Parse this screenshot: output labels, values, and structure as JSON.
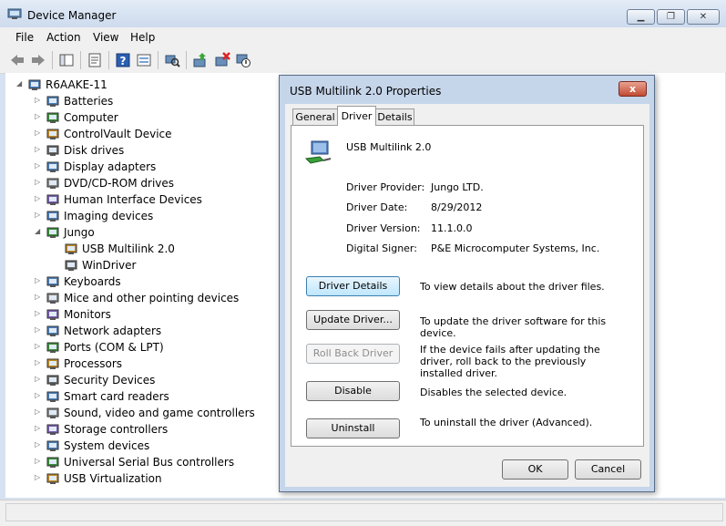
{
  "window": {
    "title": "Device Manager"
  },
  "menu": [
    "File",
    "Action",
    "View",
    "Help"
  ],
  "tree": {
    "root": "R6AAKE-11",
    "items": [
      {
        "label": "Batteries",
        "expanded": false
      },
      {
        "label": "Computer",
        "expanded": false
      },
      {
        "label": "ControlVault Device",
        "expanded": false
      },
      {
        "label": "Disk drives",
        "expanded": false
      },
      {
        "label": "Display adapters",
        "expanded": false
      },
      {
        "label": "DVD/CD-ROM drives",
        "expanded": false
      },
      {
        "label": "Human Interface Devices",
        "expanded": false
      },
      {
        "label": "Imaging devices",
        "expanded": false
      },
      {
        "label": "Jungo",
        "expanded": true
      },
      {
        "label": "USB Multilink 2.0",
        "child": true
      },
      {
        "label": "WinDriver",
        "child": true
      },
      {
        "label": "Keyboards",
        "expanded": false
      },
      {
        "label": "Mice and other pointing devices",
        "expanded": false
      },
      {
        "label": "Monitors",
        "expanded": false
      },
      {
        "label": "Network adapters",
        "expanded": false
      },
      {
        "label": "Ports (COM & LPT)",
        "expanded": false
      },
      {
        "label": "Processors",
        "expanded": false
      },
      {
        "label": "Security Devices",
        "expanded": false
      },
      {
        "label": "Smart card readers",
        "expanded": false
      },
      {
        "label": "Sound, video and game controllers",
        "expanded": false
      },
      {
        "label": "Storage controllers",
        "expanded": false
      },
      {
        "label": "System devices",
        "expanded": false
      },
      {
        "label": "Universal Serial Bus controllers",
        "expanded": false
      },
      {
        "label": "USB Virtualization",
        "expanded": false
      }
    ]
  },
  "dialog": {
    "title": "USB Multilink 2.0 Properties",
    "close_label": "x",
    "tabs": [
      "General",
      "Driver",
      "Details"
    ],
    "active_tab": "Driver",
    "device_name": "USB Multilink 2.0",
    "fields": [
      {
        "label": "Driver Provider:",
        "value": "Jungo LTD."
      },
      {
        "label": "Driver Date:",
        "value": "8/29/2012"
      },
      {
        "label": "Driver Version:",
        "value": "11.1.0.0"
      },
      {
        "label": "Digital Signer:",
        "value": "P&E Microcomputer Systems, Inc."
      }
    ],
    "actions": [
      {
        "button": "Driver Details",
        "desc": "To view details about the driver files.",
        "state": "focused"
      },
      {
        "button": "Update Driver...",
        "desc": "To update the driver software for this device.",
        "state": "normal"
      },
      {
        "button": "Roll Back Driver",
        "desc": "If the device fails after updating the driver, roll back to the previously installed driver.",
        "state": "disabled"
      },
      {
        "button": "Disable",
        "desc": "Disables the selected device.",
        "state": "normal"
      },
      {
        "button": "Uninstall",
        "desc": "To uninstall the driver (Advanced).",
        "state": "normal"
      }
    ],
    "ok_label": "OK",
    "cancel_label": "Cancel"
  }
}
